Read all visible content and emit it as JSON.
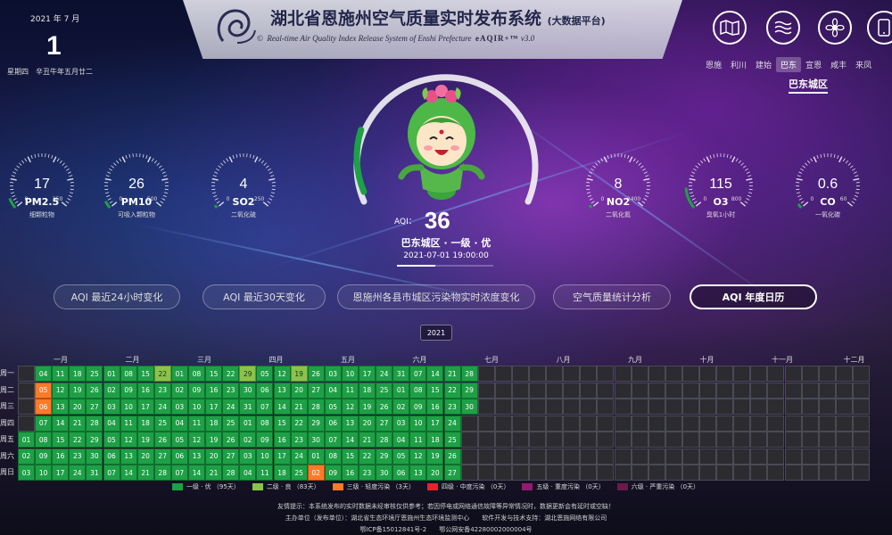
{
  "date": {
    "year_month": "2021 年 7 月",
    "day": "1",
    "weekday_lunar": "星期四　辛丑牛年五月廿二"
  },
  "header": {
    "title": "湖北省恩施州空气质量实时发布系统",
    "title_suffix": "(大数据平台)",
    "copyright": "©",
    "subtitle": "Real-time Air Quality Index Release System of Enshi Prefecture",
    "brand": "eAQIR+™",
    "version": "v3.0"
  },
  "top_icons": [
    "map-icon",
    "waves-icon",
    "flower-icon",
    "phone-icon"
  ],
  "nav": {
    "items": [
      "恩施",
      "利川",
      "建始",
      "巴东",
      "宣恩",
      "咸丰",
      "来凤"
    ],
    "active": "巴东",
    "subtab": "巴东城区"
  },
  "gauges_left": [
    {
      "value": "17",
      "name": "PM2.5",
      "cn": "细颗粒物",
      "level": 0.07,
      "max_label": "250"
    },
    {
      "value": "26",
      "name": "PM10",
      "cn": "可吸入颗粒物",
      "level": 0.05,
      "max_label": "500"
    },
    {
      "value": "4",
      "name": "SO2",
      "cn": "二氧化硫",
      "level": 0.02,
      "max_label": "250"
    }
  ],
  "gauges_right": [
    {
      "value": "8",
      "name": "NO2",
      "cn": "二氧化氮",
      "level": 0.02,
      "max_label": "2400"
    },
    {
      "value": "115",
      "name": "O3",
      "cn": "臭氧1小时",
      "level": 0.14,
      "max_label": "800"
    },
    {
      "value": "0.6",
      "name": "CO",
      "cn": "一氧化碳",
      "level": 0.03,
      "max_label": "60"
    }
  ],
  "aqi": {
    "label": "AQI：",
    "value": "36",
    "status": "巴东城区 · 一级 · 优",
    "time": "2021-07-01 19:00:00",
    "level": 0.18
  },
  "tabs": [
    {
      "label": "AQI 最近24小时变化",
      "active": false
    },
    {
      "label": "AQI 最近30天变化",
      "active": false
    },
    {
      "label": "恩施州各县市城区污染物实时浓度变化",
      "active": false
    },
    {
      "label": "空气质量统计分析",
      "active": false
    },
    {
      "label": "AQI 年度日历",
      "active": true
    }
  ],
  "calendar": {
    "year": "2021",
    "months": [
      "一月",
      "二月",
      "三月",
      "四月",
      "五月",
      "六月",
      "七月",
      "八月",
      "九月",
      "十月",
      "十一月",
      "十二月"
    ],
    "weekdays": [
      "周一",
      "周二",
      "周三",
      "周四",
      "周五",
      "周六",
      "周日"
    ],
    "total_weeks": 50,
    "rows": [
      [
        "",
        "04:1",
        "11:1",
        "18:1",
        "25:1",
        "01:1",
        "08:1",
        "15:1",
        "22:2",
        "01:1",
        "08:1",
        "15:1",
        "22:1",
        "29:2",
        "05:1",
        "12:1",
        "19:2",
        "26:1",
        "03:1",
        "10:1",
        "17:1",
        "24:1",
        "31:1",
        "07:1",
        "14:1",
        "21:1",
        "28:1"
      ],
      [
        "",
        "05:3",
        "12:1",
        "19:1",
        "26:1",
        "02:1",
        "09:1",
        "16:1",
        "23:1",
        "02:1",
        "09:1",
        "16:1",
        "23:1",
        "30:1",
        "06:1",
        "13:1",
        "20:1",
        "27:1",
        "04:1",
        "11:1",
        "18:1",
        "25:1",
        "01:1",
        "08:1",
        "15:1",
        "22:1",
        "29:1"
      ],
      [
        "",
        "06:3",
        "13:1",
        "20:1",
        "27:1",
        "03:1",
        "10:1",
        "17:1",
        "24:1",
        "03:1",
        "10:1",
        "17:1",
        "24:1",
        "31:1",
        "07:1",
        "14:1",
        "21:1",
        "28:1",
        "05:1",
        "12:1",
        "19:1",
        "26:1",
        "02:1",
        "09:1",
        "16:1",
        "23:1",
        "30:1"
      ],
      [
        "",
        "07:1",
        "14:1",
        "21:1",
        "28:1",
        "04:1",
        "11:1",
        "18:1",
        "25:1",
        "04:1",
        "11:1",
        "18:1",
        "25:1",
        "01:1",
        "08:1",
        "15:1",
        "22:1",
        "29:1",
        "06:1",
        "13:1",
        "20:1",
        "27:1",
        "03:1",
        "10:1",
        "17:1",
        "24:1",
        ""
      ],
      [
        "01:1",
        "08:1",
        "15:1",
        "22:1",
        "29:1",
        "05:1",
        "12:1",
        "19:1",
        "26:1",
        "05:1",
        "12:1",
        "19:1",
        "26:1",
        "02:1",
        "09:1",
        "16:1",
        "23:1",
        "30:1",
        "07:1",
        "14:1",
        "21:1",
        "28:1",
        "04:1",
        "11:1",
        "18:1",
        "25:1",
        ""
      ],
      [
        "02:1",
        "09:1",
        "16:1",
        "23:1",
        "30:1",
        "06:1",
        "13:1",
        "20:1",
        "27:1",
        "06:1",
        "13:1",
        "20:1",
        "27:1",
        "03:1",
        "10:1",
        "17:1",
        "24:1",
        "01:1",
        "08:1",
        "15:1",
        "22:1",
        "29:1",
        "05:1",
        "12:1",
        "19:1",
        "26:1",
        ""
      ],
      [
        "03:1",
        "10:1",
        "17:1",
        "24:1",
        "31:1",
        "07:1",
        "14:1",
        "21:1",
        "28:1",
        "07:1",
        "14:1",
        "21:1",
        "28:1",
        "04:1",
        "11:1",
        "18:1",
        "25:1",
        "02:3",
        "09:1",
        "16:1",
        "23:1",
        "30:1",
        "06:1",
        "13:1",
        "20:1",
        "27:1",
        ""
      ]
    ],
    "level_colors": {
      "1": "#1ea046",
      "2": "#8bc34a",
      "3": "#ff7a28"
    }
  },
  "legend": [
    {
      "label": "一级 · 优 （95天）",
      "color": "#1ea046"
    },
    {
      "label": "二级 · 良 （83天）",
      "color": "#8bc34a"
    },
    {
      "label": "三级 · 轻度污染 （3天）",
      "color": "#ff7a28"
    },
    {
      "label": "四级 · 中度污染 （0天）",
      "color": "#e8212b"
    },
    {
      "label": "五级 · 重度污染 （0天）",
      "color": "#8e1d6e"
    },
    {
      "label": "六级 · 严重污染 （0天）",
      "color": "#6a1a4a"
    }
  ],
  "footer": {
    "line1": "友情提示：本系统发布的实时数据未经审核仅供参考；若因停电或网络通信故障等异常情况时，数据更新会有延时或空缺！",
    "line2": "主办单位（发布单位）：湖北省生态环境厅恩施州生态环境监测中心　　软件开发与技术支持：湖北恩施网络有限公司",
    "line3": "鄂ICP备15012841号-2　　鄂公网安备42280002000004号"
  }
}
